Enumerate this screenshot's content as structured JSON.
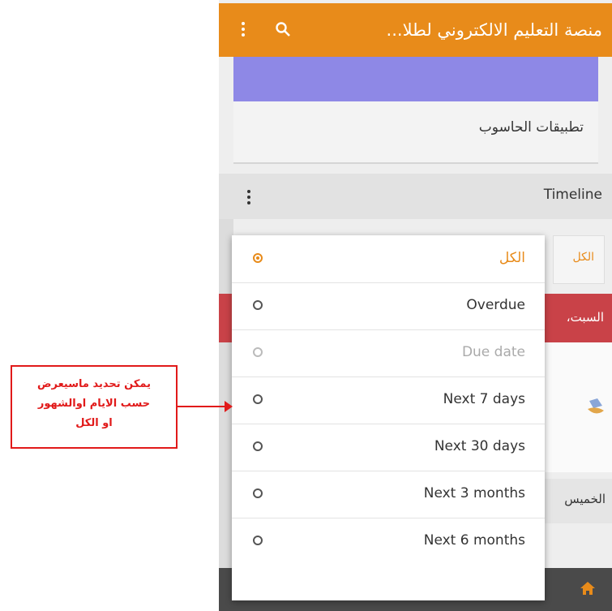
{
  "appbar": {
    "title": "منصة التعليم الالكتروني لطلا...",
    "bg": "#e88b1a"
  },
  "course": {
    "name": "تطبيقات الحاسوب"
  },
  "timeline": {
    "label": "Timeline"
  },
  "filter": {
    "button_label": "الكل"
  },
  "day_headers": {
    "saturday": "السبت، ",
    "thursday": "الخميس"
  },
  "menu": {
    "options": [
      {
        "label": "الكل",
        "selected": true,
        "disabled": false
      },
      {
        "label": "Overdue",
        "selected": false,
        "disabled": false
      },
      {
        "label": "Due date",
        "selected": false,
        "disabled": true
      },
      {
        "label": "Next 7 days",
        "selected": false,
        "disabled": false
      },
      {
        "label": "Next 30 days",
        "selected": false,
        "disabled": false
      },
      {
        "label": "Next 3 months",
        "selected": false,
        "disabled": false
      },
      {
        "label": "Next 6 months",
        "selected": false,
        "disabled": false
      }
    ]
  },
  "callout": {
    "line1": "يمكن تحديد ماسيعرض",
    "line2": "حسب الايام اوالشهور",
    "line3": "او الكل"
  },
  "colors": {
    "accent": "#e88b1a",
    "banner": "#8e88e6",
    "red": "#c94248",
    "callout": "#e11a1a"
  }
}
